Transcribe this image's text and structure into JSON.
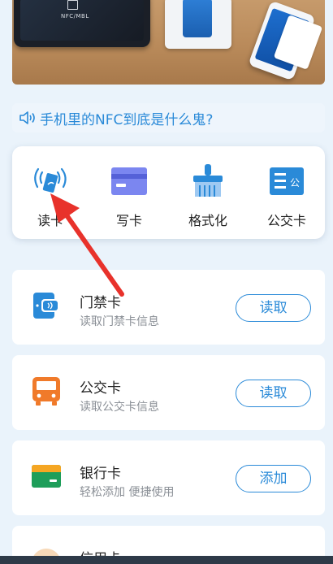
{
  "hero": {
    "tablet_brand": "NFC∕MBL"
  },
  "notice": {
    "text": "手机里的NFC到底是什么鬼?"
  },
  "functions": [
    {
      "label": "读卡",
      "icon": "nfc-read-icon"
    },
    {
      "label": "写卡",
      "icon": "write-card-icon"
    },
    {
      "label": "格式化",
      "icon": "format-brush-icon"
    },
    {
      "label": "公交卡",
      "icon": "bus-card-icon"
    }
  ],
  "cards": [
    {
      "title": "门禁卡",
      "subtitle": "读取门禁卡信息",
      "button": "读取",
      "icon": "access-card-icon"
    },
    {
      "title": "公交卡",
      "subtitle": "读取公交卡信息",
      "button": "读取",
      "icon": "bus-icon"
    },
    {
      "title": "银行卡",
      "subtitle": "轻松添加 便捷使用",
      "button": "添加",
      "icon": "bank-card-icon"
    },
    {
      "title": "信用卡",
      "subtitle": "",
      "button": "",
      "icon": "credit-card-icon"
    }
  ],
  "colors": {
    "accent": "#2a8ad8",
    "bus_orange": "#f07a2a",
    "bank_green": "#1e9e5a",
    "card_purple": "#7b86f0"
  }
}
